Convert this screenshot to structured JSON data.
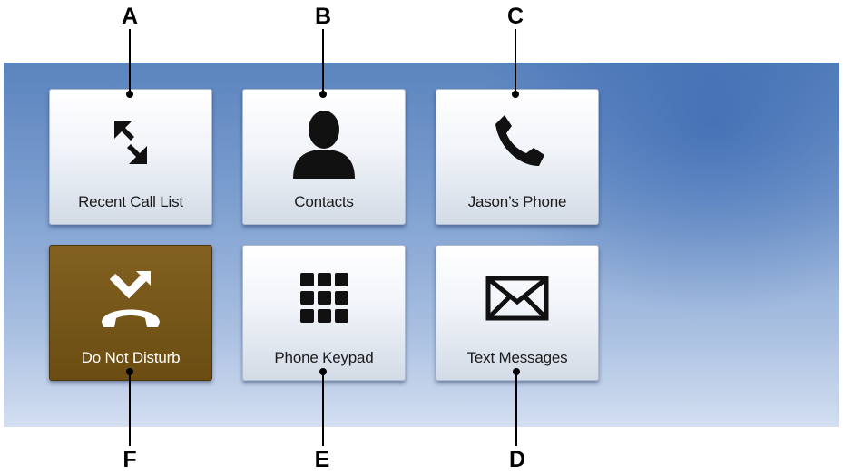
{
  "callouts": {
    "a": "A",
    "b": "B",
    "c": "C",
    "d": "D",
    "e": "E",
    "f": "F"
  },
  "tiles": [
    {
      "label": "Recent Call List",
      "icon": "recent-calls-icon"
    },
    {
      "label": "Contacts",
      "icon": "contact-person-icon"
    },
    {
      "label": "Jason’s Phone",
      "icon": "phone-handset-icon"
    },
    {
      "label": "Do Not Disturb",
      "icon": "do-not-disturb-icon",
      "state": "active"
    },
    {
      "label": "Phone Keypad",
      "icon": "keypad-icon"
    },
    {
      "label": "Text Messages",
      "icon": "envelope-icon"
    }
  ],
  "colors": {
    "screen_top": "#5b84be",
    "screen_bottom": "#d3def0",
    "tile_face": "#f1f4f9",
    "dnd_active": "#6b4d13"
  }
}
